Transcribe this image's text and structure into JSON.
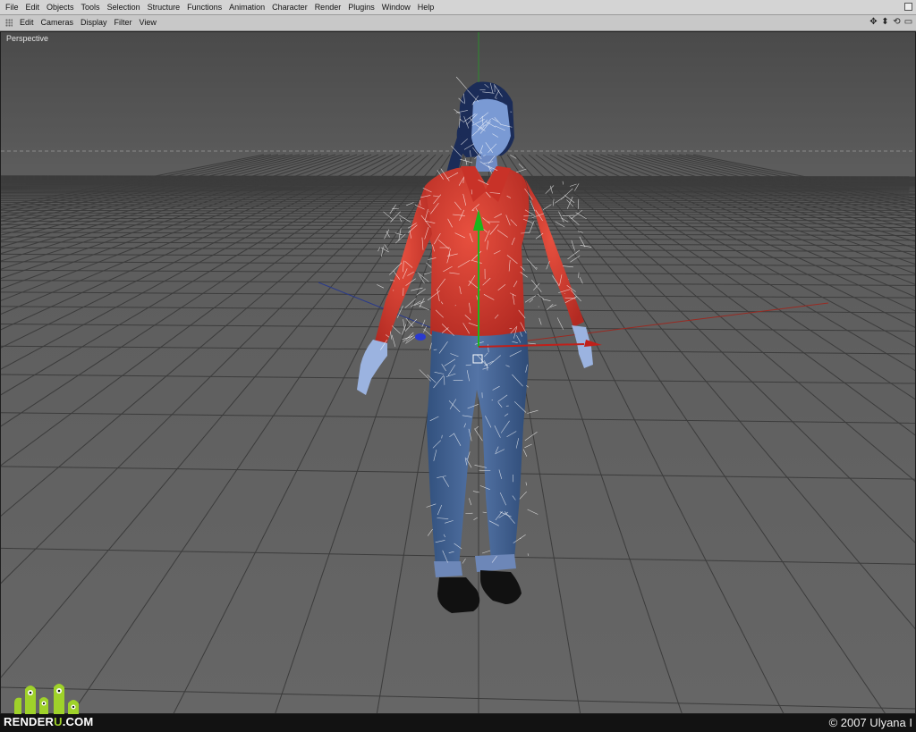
{
  "menubar": {
    "items": [
      "File",
      "Edit",
      "Objects",
      "Tools",
      "Selection",
      "Structure",
      "Functions",
      "Animation",
      "Character",
      "Render",
      "Plugins",
      "Window",
      "Help"
    ]
  },
  "viewbar": {
    "items": [
      "Edit",
      "Cameras",
      "Display",
      "Filter",
      "View"
    ],
    "nav_icons": [
      "move-view-icon",
      "dolly-view-icon",
      "rotate-view-icon",
      "maximize-view-icon"
    ]
  },
  "viewport": {
    "label": "Perspective"
  },
  "footer": {
    "brand_prefix": "RENDER",
    "brand_u": "U",
    "brand_suffix": ".COM",
    "copyright": "© 2007 Ulyana I"
  },
  "colors": {
    "shirt": "#d8392e",
    "jeans": "#3e5f92",
    "wire": "#ffffff",
    "hair": "#1b2c58",
    "x_axis": "#c0201a",
    "y_axis": "#1cb51c",
    "z_axis": "#2a3ad0",
    "logo_green": "#9fd22a"
  }
}
